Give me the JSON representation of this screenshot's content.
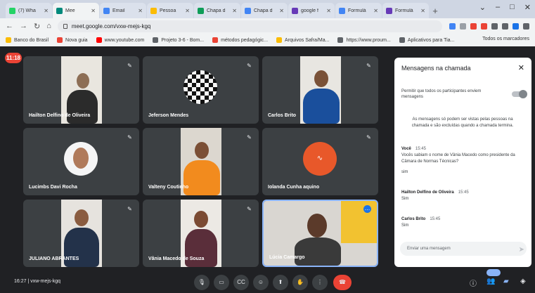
{
  "browser": {
    "tabs": [
      {
        "title": "(7) Wha",
        "fav": "#25d366"
      },
      {
        "title": "Mee",
        "fav": "#00897b",
        "active": true
      },
      {
        "title": "Email",
        "fav": "#4285f4"
      },
      {
        "title": "Pessoa",
        "fav": "#fbbc04"
      },
      {
        "title": "Chapa d",
        "fav": "#0f9d58"
      },
      {
        "title": "Chapa d",
        "fav": "#4285f4"
      },
      {
        "title": "google f",
        "fav": "#673ab7"
      },
      {
        "title": "Formulá",
        "fav": "#4285f4"
      },
      {
        "title": "Formulá",
        "fav": "#673ab7"
      }
    ],
    "url": "meet.google.com/vxw-mejs-kgq",
    "bookmarks": [
      "Banco do Brasil",
      "Nova guia",
      "www.youtube.com",
      "Projeto 3-6 - Bom...",
      "métodos pedagógic...",
      "Arquivos Safra/Ma...",
      "https://www.proum...",
      "Aplicativos para Tia..."
    ],
    "bookmarks_right": "Todos os marcadores"
  },
  "meeting": {
    "timer": "11:18",
    "time": "16:27",
    "code": "vxw-mejs-kgq",
    "participants": [
      {
        "name": "Hailton Delfino de Oliveira"
      },
      {
        "name": "Jeferson Mendes"
      },
      {
        "name": "Carlos Brito"
      },
      {
        "name": "Lucimbs Davi Rocha"
      },
      {
        "name": "Valteny Coutinho"
      },
      {
        "name": "Iolanda Cunha aquino"
      },
      {
        "name": "JULIANO ABRANTES"
      },
      {
        "name": "Vânia Macedo de Souza"
      },
      {
        "name": "Lúcia Camargo"
      }
    ]
  },
  "chat": {
    "title": "Mensagens na chamada",
    "allow_text": "Permitir que todos os participantes enviem mensagens",
    "info": "As mensagens só podem ser vistas pelas pessoas na chamada e são excluídas quando a chamada termina.",
    "messages": [
      {
        "sender": "Você",
        "time": "15:45",
        "text": "Vocês sabiam o nome de Vânia Macedo como presidente da Câmara de Normas Técnicas?",
        "reply": "sim"
      },
      {
        "sender": "Hailton Delfino de Oliveira",
        "time": "15:45",
        "text": "Sim"
      },
      {
        "sender": "Carlos Brito",
        "time": "15:45",
        "text": "Sim"
      }
    ],
    "composer_placeholder": "Enviar uma mensagem",
    "send_icon": "send-icon"
  },
  "colors": {
    "hangup": "#ea4335",
    "tile": "#3c4043",
    "accent": "#8ab4f8"
  }
}
